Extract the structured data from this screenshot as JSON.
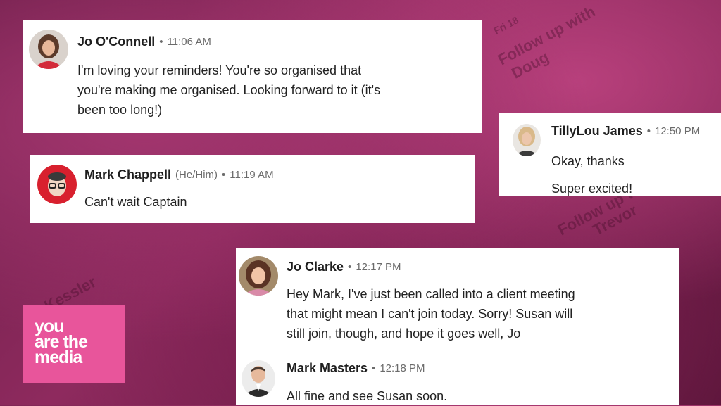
{
  "messages": [
    {
      "name": "Jo O'Connell",
      "pronouns": "",
      "time": "11:06 AM",
      "lines": [
        "I'm loving your reminders! You're so organised that",
        "you're making me organised. Looking forward to it (it's",
        "been too long!)"
      ]
    },
    {
      "name": "Mark Chappell",
      "pronouns": "(He/Him)",
      "time": "11:19 AM",
      "lines": [
        "Can't wait Captain"
      ]
    },
    {
      "name": "TillyLou James",
      "pronouns": "",
      "time": "12:50 PM",
      "lines": [
        "Okay, thanks",
        "Super excited!"
      ]
    },
    {
      "name": "Jo Clarke",
      "pronouns": "",
      "time": "12:17 PM",
      "lines": [
        "Hey Mark, I've just been called into a client meeting",
        "that might mean I can't join today. Sorry! Susan will",
        "still join, though, and hope it goes well, Jo"
      ]
    },
    {
      "name": "Mark Masters",
      "pronouns": "",
      "time": "12:18 PM",
      "lines": [
        "All fine and see Susan soon."
      ]
    }
  ],
  "separator": "•",
  "logo": {
    "lines": [
      "you",
      "are the",
      "media"
    ],
    "color": "#e8559b"
  },
  "background_words": [
    "Follow up with",
    "Doug",
    "Follow up with",
    "Trevor",
    "Kessler",
    "Fri 18"
  ],
  "colors": {
    "background": "#8e2a5e",
    "card": "#ffffff",
    "meta_text": "#6b6b6b"
  }
}
